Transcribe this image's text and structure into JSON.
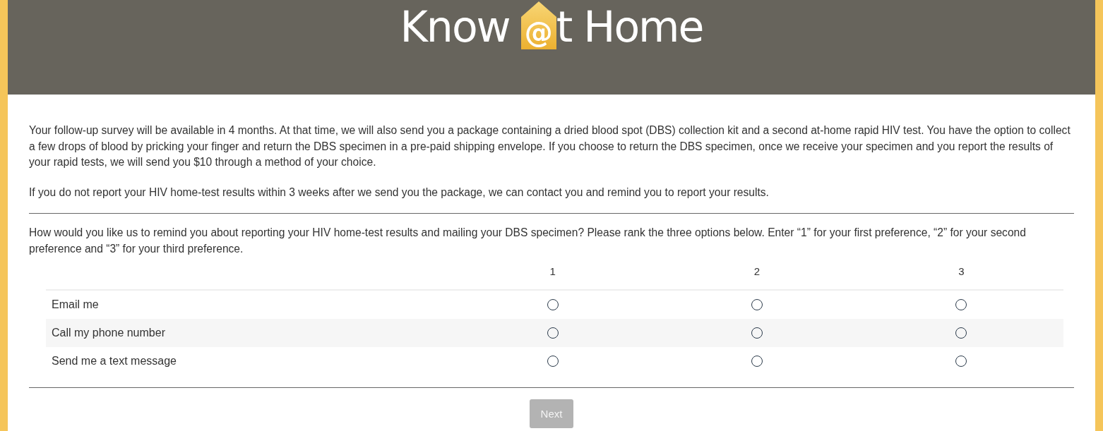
{
  "logo": {
    "before": "Know",
    "mark": "@",
    "after": "t Home"
  },
  "intro": [
    "Your follow-up survey will be available in 4 months. At that time, we will also send you a package containing a dried blood spot (DBS) collection kit and a second at-home rapid HIV test. You have the option to collect a few drops of blood by pricking your finger and return the DBS specimen in a pre-paid shipping envelope. If you choose to return the DBS specimen, once we receive your specimen and you report the results of your rapid tests, we will send you $10 through a method of your choice.",
    "If you do not report your HIV home-test results within 3 weeks after we send you the package, we can contact you and remind you to report your results."
  ],
  "question": "How would you like us to remind you about reporting your HIV home-test results and mailing your DBS specimen? Please rank the three options below. Enter “1” for your first preference, “2” for your second preference and “3” for your third preference.",
  "columns": [
    "1",
    "2",
    "3"
  ],
  "rows": [
    {
      "label": "Email me",
      "choices": [
        {
          "selected": false
        },
        {
          "selected": false
        },
        {
          "selected": false
        }
      ]
    },
    {
      "label": "Call my phone number",
      "choices": [
        {
          "selected": false
        },
        {
          "selected": false
        },
        {
          "selected": false
        }
      ]
    },
    {
      "label": "Send me a text message",
      "choices": [
        {
          "selected": false
        },
        {
          "selected": false
        },
        {
          "selected": false
        }
      ]
    }
  ],
  "next_button": {
    "label": "Next",
    "disabled": true
  }
}
